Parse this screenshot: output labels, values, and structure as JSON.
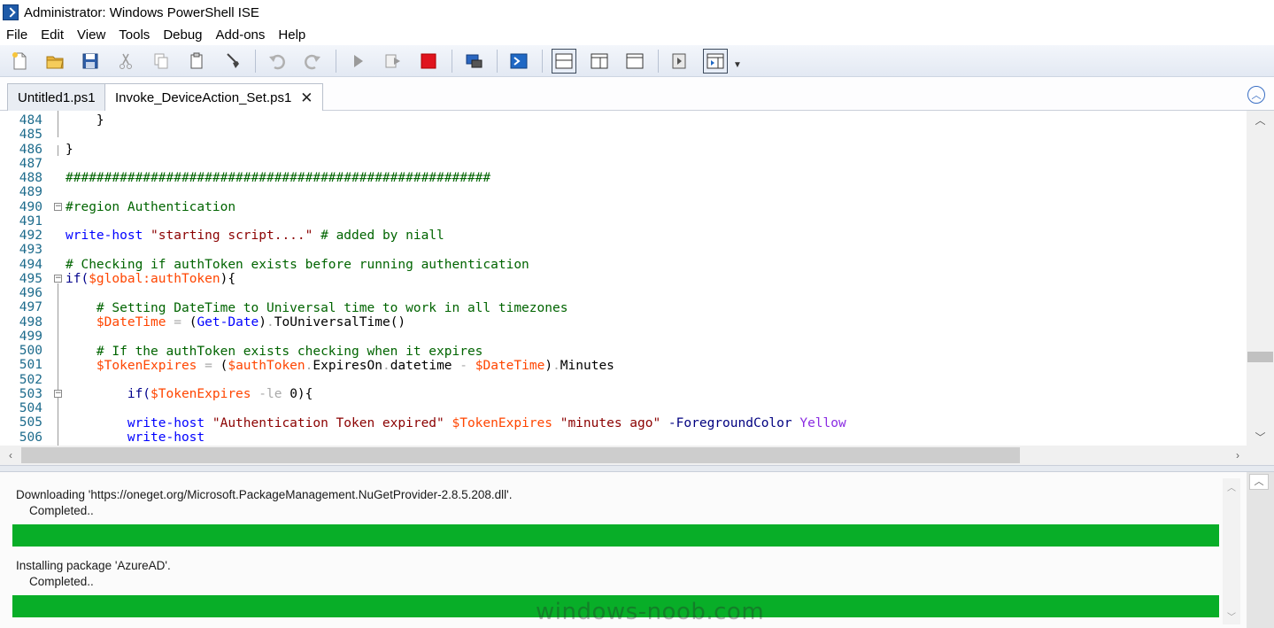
{
  "window": {
    "title": "Administrator: Windows PowerShell ISE"
  },
  "menu": [
    "File",
    "Edit",
    "View",
    "Tools",
    "Debug",
    "Add-ons",
    "Help"
  ],
  "toolbar": {
    "buttons": [
      "new-script",
      "open",
      "save",
      "cut",
      "copy",
      "paste",
      "clear-console",
      "undo",
      "redo",
      "run-script",
      "run-selection",
      "stop",
      "new-remote-powershell-tab",
      "start-powershell-exe",
      "show-script-pane-top",
      "show-script-pane-right",
      "show-script-pane-maximized",
      "show-script-pane",
      "show-command-addon"
    ]
  },
  "tabs": [
    {
      "label": "Untitled1.ps1"
    },
    {
      "label": "Invoke_DeviceAction_Set.ps1",
      "close": "✕"
    }
  ],
  "editor": {
    "lines": [
      {
        "n": "484"
      },
      {
        "n": "485"
      },
      {
        "n": "486"
      },
      {
        "n": "487"
      },
      {
        "n": "488"
      },
      {
        "n": "489"
      },
      {
        "n": "490"
      },
      {
        "n": "491"
      },
      {
        "n": "492"
      },
      {
        "n": "493"
      },
      {
        "n": "494"
      },
      {
        "n": "495"
      },
      {
        "n": "496"
      },
      {
        "n": "497"
      },
      {
        "n": "498"
      },
      {
        "n": "499"
      },
      {
        "n": "500"
      },
      {
        "n": "501"
      },
      {
        "n": "502"
      },
      {
        "n": "503"
      },
      {
        "n": "504"
      },
      {
        "n": "505"
      },
      {
        "n": "506"
      }
    ],
    "code": {
      "l484": "    }",
      "l486": "}",
      "l488": "#######################################################",
      "l490": "#region Authentication",
      "l492_cmd": "write-host",
      "l492_str": " \"starting script....\"",
      "l492_cmt": " # added by niall",
      "l494": "# Checking if authToken exists before running authentication",
      "l495_a": "if(",
      "l495_var": "$global:authToken",
      "l495_b": "){",
      "l497": "    # Setting DateTime to Universal time to work in all timezones",
      "l498_var": "    $DateTime",
      "l498_op": " = ",
      "l498_a": "(",
      "l498_cmd": "Get-Date",
      "l498_b": ")",
      "l498_dot": ".",
      "l498_mem": "ToUniversalTime()",
      "l500": "    # If the authToken exists checking when it expires",
      "l501_var1": "    $TokenExpires",
      "l501_op1": " = ",
      "l501_a": "(",
      "l501_var2": "$authToken",
      "l501_dot1": ".",
      "l501_mem1": "ExpiresOn",
      "l501_dot2": ".",
      "l501_mem2": "datetime",
      "l501_op2": " - ",
      "l501_var3": "$DateTime",
      "l501_b": ")",
      "l501_dot3": ".",
      "l501_mem3": "Minutes",
      "l503_a": "        if(",
      "l503_var": "$TokenExpires",
      "l503_op": " -le ",
      "l503_num": "0",
      "l503_b": "){",
      "l505_cmd": "        write-host",
      "l505_str1": " \"Authentication Token expired\"",
      "l505_var": " $TokenExpires",
      "l505_str2": " \"minutes ago\"",
      "l505_param": " -ForegroundColor",
      "l505_val": " Yellow",
      "l506_cmd": "        write-host"
    }
  },
  "console": {
    "progress": [
      {
        "text": "Downloading 'https://oneget.org/Microsoft.PackageManagement.NuGetProvider-2.8.5.208.dll'.",
        "status": "Completed..",
        "percent": 100
      },
      {
        "text": "Installing package 'AzureAD'.",
        "status": "Completed..",
        "percent": 100
      }
    ],
    "bar_color": "#08ae28"
  },
  "watermark": "windows-noob.com"
}
